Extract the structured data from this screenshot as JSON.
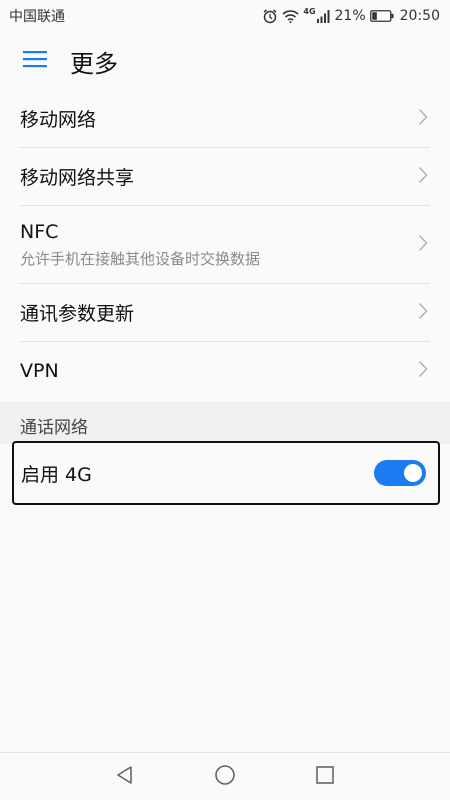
{
  "status_bar": {
    "carrier": "中国联通",
    "network_type": "4G",
    "battery": "21%",
    "time": "20:50",
    "icons": [
      "alarm-icon",
      "wifi-icon",
      "signal-icon",
      "battery-icon"
    ]
  },
  "header": {
    "title": "更多",
    "menu_icon": "menu-icon"
  },
  "settings": [
    {
      "label": "移动网络"
    },
    {
      "label": "移动网络共享"
    },
    {
      "label": "NFC",
      "subtitle": "允许手机在接触其他设备时交换数据"
    },
    {
      "label": "通讯参数更新"
    },
    {
      "label": "VPN"
    }
  ],
  "call_network": {
    "section_title": "通话网络",
    "enable_4g_label": "启用 4G",
    "enable_4g_on": true
  },
  "nav_bar": {
    "icons": [
      "back-icon",
      "home-icon",
      "recents-icon"
    ]
  },
  "colors": {
    "accent": "#1a7cf0",
    "background": "#fafafa",
    "section_bg": "#f0f0f0",
    "divider": "#e2e2e2"
  }
}
